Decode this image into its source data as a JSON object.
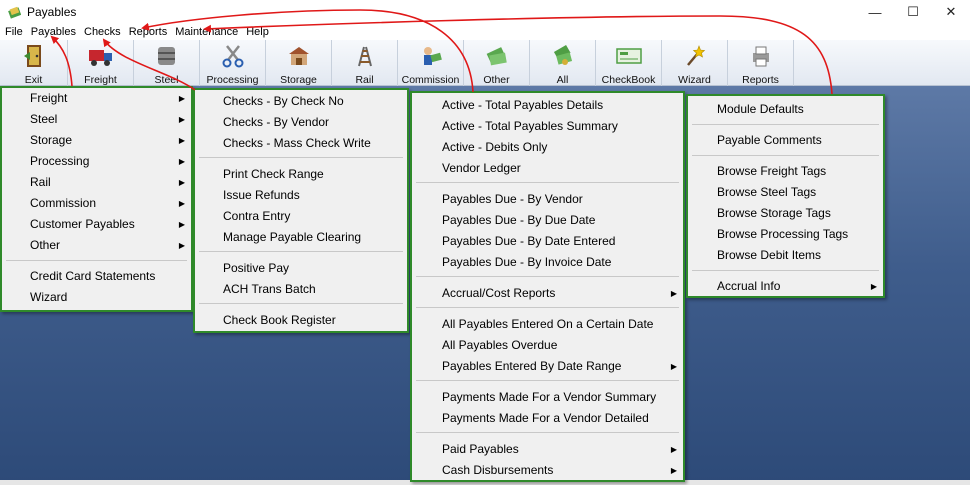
{
  "window": {
    "title": "Payables",
    "minimize": "—",
    "maximize": "☐",
    "close": "✕"
  },
  "menubar": [
    "File",
    "Payables",
    "Checks",
    "Reports",
    "Maintenance",
    "Help"
  ],
  "toolbar": [
    {
      "label": "Exit",
      "icon": "exit-door-icon"
    },
    {
      "label": "Freight",
      "icon": "truck-icon"
    },
    {
      "label": "Steel",
      "icon": "steel-barrel-icon"
    },
    {
      "label": "Processing",
      "icon": "scissors-icon"
    },
    {
      "label": "Storage",
      "icon": "storage-building-icon"
    },
    {
      "label": "Rail",
      "icon": "rail-icon"
    },
    {
      "label": "Commission",
      "icon": "commission-money-icon"
    },
    {
      "label": "Other",
      "icon": "other-money-icon"
    },
    {
      "label": "All",
      "icon": "all-money-icon"
    },
    {
      "label": "CheckBook",
      "icon": "checkbook-icon"
    },
    {
      "label": "Wizard",
      "icon": "wizard-wand-icon"
    },
    {
      "label": "Reports",
      "icon": "reports-icon"
    }
  ],
  "menus": {
    "payables": {
      "items": [
        {
          "label": "Freight",
          "submenu": true
        },
        {
          "label": "Steel",
          "submenu": true
        },
        {
          "label": "Storage",
          "submenu": true
        },
        {
          "label": "Processing",
          "submenu": true
        },
        {
          "label": "Rail",
          "submenu": true
        },
        {
          "label": "Commission",
          "submenu": true
        },
        {
          "label": "Customer Payables",
          "submenu": true
        },
        {
          "label": "Other",
          "submenu": true
        },
        {
          "label": "Credit Card Statements",
          "submenu": false
        },
        {
          "label": "Wizard",
          "submenu": false
        }
      ]
    },
    "checks": {
      "items": [
        {
          "label": "Checks - By Check No"
        },
        {
          "label": "Checks - By Vendor"
        },
        {
          "label": "Checks - Mass Check Write"
        },
        {
          "label": "Print Check Range"
        },
        {
          "label": "Issue Refunds"
        },
        {
          "label": "Contra Entry"
        },
        {
          "label": "Manage Payable Clearing"
        },
        {
          "label": "Positive Pay"
        },
        {
          "label": "ACH Trans Batch"
        },
        {
          "label": "Check Book Register"
        }
      ]
    },
    "reports": {
      "items": [
        {
          "label": "Active - Total Payables Details",
          "submenu": false
        },
        {
          "label": "Active - Total Payables Summary",
          "submenu": false
        },
        {
          "label": "Active - Debits Only",
          "submenu": false
        },
        {
          "label": "Vendor Ledger",
          "submenu": false
        },
        {
          "label": "Payables Due - By Vendor",
          "submenu": false
        },
        {
          "label": "Payables Due - By Due Date",
          "submenu": false
        },
        {
          "label": "Payables Due - By Date Entered",
          "submenu": false
        },
        {
          "label": "Payables Due - By Invoice Date",
          "submenu": false
        },
        {
          "label": "Accrual/Cost Reports",
          "submenu": true
        },
        {
          "label": "All Payables Entered On a Certain Date",
          "submenu": false
        },
        {
          "label": "All Payables Overdue",
          "submenu": false
        },
        {
          "label": "Payables Entered By Date Range",
          "submenu": true
        },
        {
          "label": "Payments Made For a Vendor Summary",
          "submenu": false
        },
        {
          "label": "Payments Made For a Vendor Detailed",
          "submenu": false
        },
        {
          "label": "Paid Payables",
          "submenu": true
        },
        {
          "label": "Cash Disbursements",
          "submenu": true
        }
      ]
    },
    "maintenance": {
      "items": [
        {
          "label": "Module Defaults",
          "submenu": false
        },
        {
          "label": "Payable Comments",
          "submenu": false
        },
        {
          "label": "Browse Freight Tags",
          "submenu": false
        },
        {
          "label": "Browse Steel Tags",
          "submenu": false
        },
        {
          "label": "Browse Storage Tags",
          "submenu": false
        },
        {
          "label": "Browse Processing Tags",
          "submenu": false
        },
        {
          "label": "Browse Debit Items",
          "submenu": false
        },
        {
          "label": "Accrual Info",
          "submenu": true
        }
      ]
    }
  },
  "submenu_arrow": "▶",
  "colors": {
    "menu_border": "#2f8a2a",
    "annotation_arrow": "#e01818",
    "workspace": "#3f5d8c"
  }
}
